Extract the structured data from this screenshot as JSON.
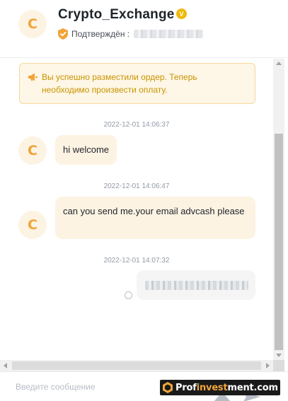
{
  "header": {
    "avatar_letter": "C",
    "title": "Crypto_Exchange",
    "verified_mark": "V",
    "verified_label": "Подтверждён :",
    "icons": [
      "verified-badge-icon",
      "shield-check-icon"
    ]
  },
  "notice": {
    "text": "Вы успешно разместили ордер. Теперь необходимо произвести оплату.",
    "icon": "megaphone-icon"
  },
  "messages": [
    {
      "timestamp": "2022-12-01 14:06:37",
      "sender": "counterparty",
      "avatar_letter": "C",
      "text": "hi welcome"
    },
    {
      "timestamp": "2022-12-01 14:06:47",
      "sender": "counterparty",
      "avatar_letter": "C",
      "text": "can you send me.your email advcash please"
    },
    {
      "timestamp": "2022-12-01 14:07:32",
      "sender": "self",
      "text": ""
    }
  ],
  "input": {
    "placeholder": "Введите сообщение"
  },
  "watermark": {
    "prefix": "Prof",
    "accent": "invest",
    "suffix": "ment.com"
  },
  "colors": {
    "accent": "#f0a43a",
    "notice_bg": "#fef6e6",
    "notice_text": "#c99400",
    "bubble_in": "#fdf3e3",
    "bubble_out": "#f5f5f5"
  }
}
